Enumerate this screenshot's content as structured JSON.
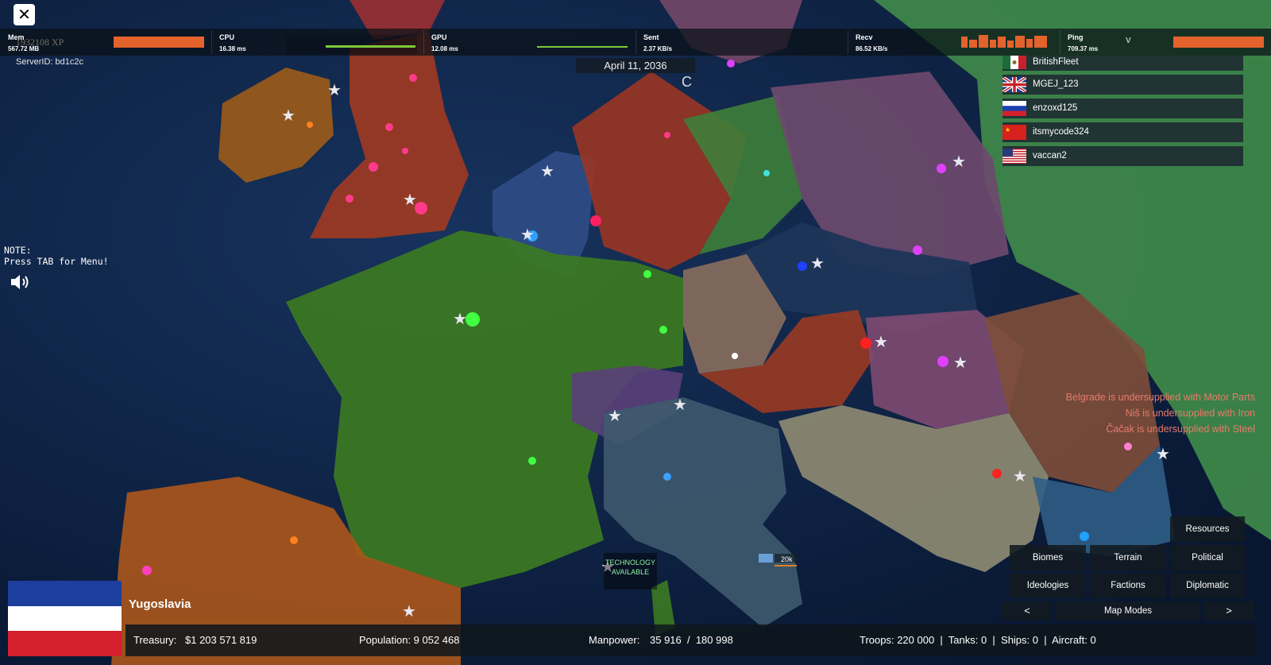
{
  "top": {
    "close_glyph": "✕",
    "xp": "1932108 XP",
    "server_id": "ServerID: bd1c2c",
    "date": "April 11, 2036",
    "c_glyph": "C"
  },
  "perf": {
    "mem": {
      "label": "Mem",
      "value": "567.72 MB"
    },
    "cpu": {
      "label": "CPU",
      "value": "16.38 ms"
    },
    "gpu": {
      "label": "GPU",
      "value": "12.08 ms"
    },
    "sent": {
      "label": "Sent",
      "value": "2.37 KB/s"
    },
    "recv": {
      "label": "Recv",
      "value": "86.52 KB/s"
    },
    "ping": {
      "label": "Ping",
      "value": "709.37 ms",
      "marker": "V"
    }
  },
  "players": [
    {
      "name": "BritishFleet",
      "flag": "mexico"
    },
    {
      "name": "MGEJ_123",
      "flag": "uk"
    },
    {
      "name": "enzoxd125",
      "flag": "russia"
    },
    {
      "name": "itsmycode324",
      "flag": "china"
    },
    {
      "name": "vaccan2",
      "flag": "usa"
    }
  ],
  "note": "NOTE:\nPress TAB for Menu!",
  "sound_icon": "speaker-icon",
  "alerts": [
    "Belgrade is undersupplied with Motor Parts",
    "Niš is undersupplied with Iron",
    "Čačak is undersupplied with Steel"
  ],
  "tech": {
    "line1": "TECHNOLOGY",
    "line2": "AVAILABLE"
  },
  "unit_label": "20k",
  "map_modes": {
    "resources": "Resources",
    "biomes": "Biomes",
    "terrain": "Terrain",
    "political": "Political",
    "ideologies": "Ideologies",
    "factions": "Factions",
    "diplomatic": "Diplomatic",
    "prev": "<",
    "title": "Map Modes",
    "next": ">"
  },
  "country": {
    "name": "Yugoslavia",
    "flag_colors": [
      "#1c3f9e",
      "#ffffff",
      "#d4202c"
    ],
    "treasury_label": "Treasury:",
    "treasury_value": "$1 203 571 819",
    "population": "Population: 9 052 468",
    "manpower_label": "Manpower:",
    "manpower_value": "35 916  /  180 998",
    "military": "Troops: 220 000  |  Tanks: 0  |  Ships: 0  |  Aircraft: 0"
  },
  "colors": {
    "ocean": "#0d2248",
    "france": "#3c7a22",
    "germany_red": "#9a3524",
    "poland_purple": "#6d4a6e",
    "spain": "#a8561c",
    "alert": "#e87a6a",
    "bar_orange": "#e4622c",
    "bar_green": "#7ec93a"
  }
}
